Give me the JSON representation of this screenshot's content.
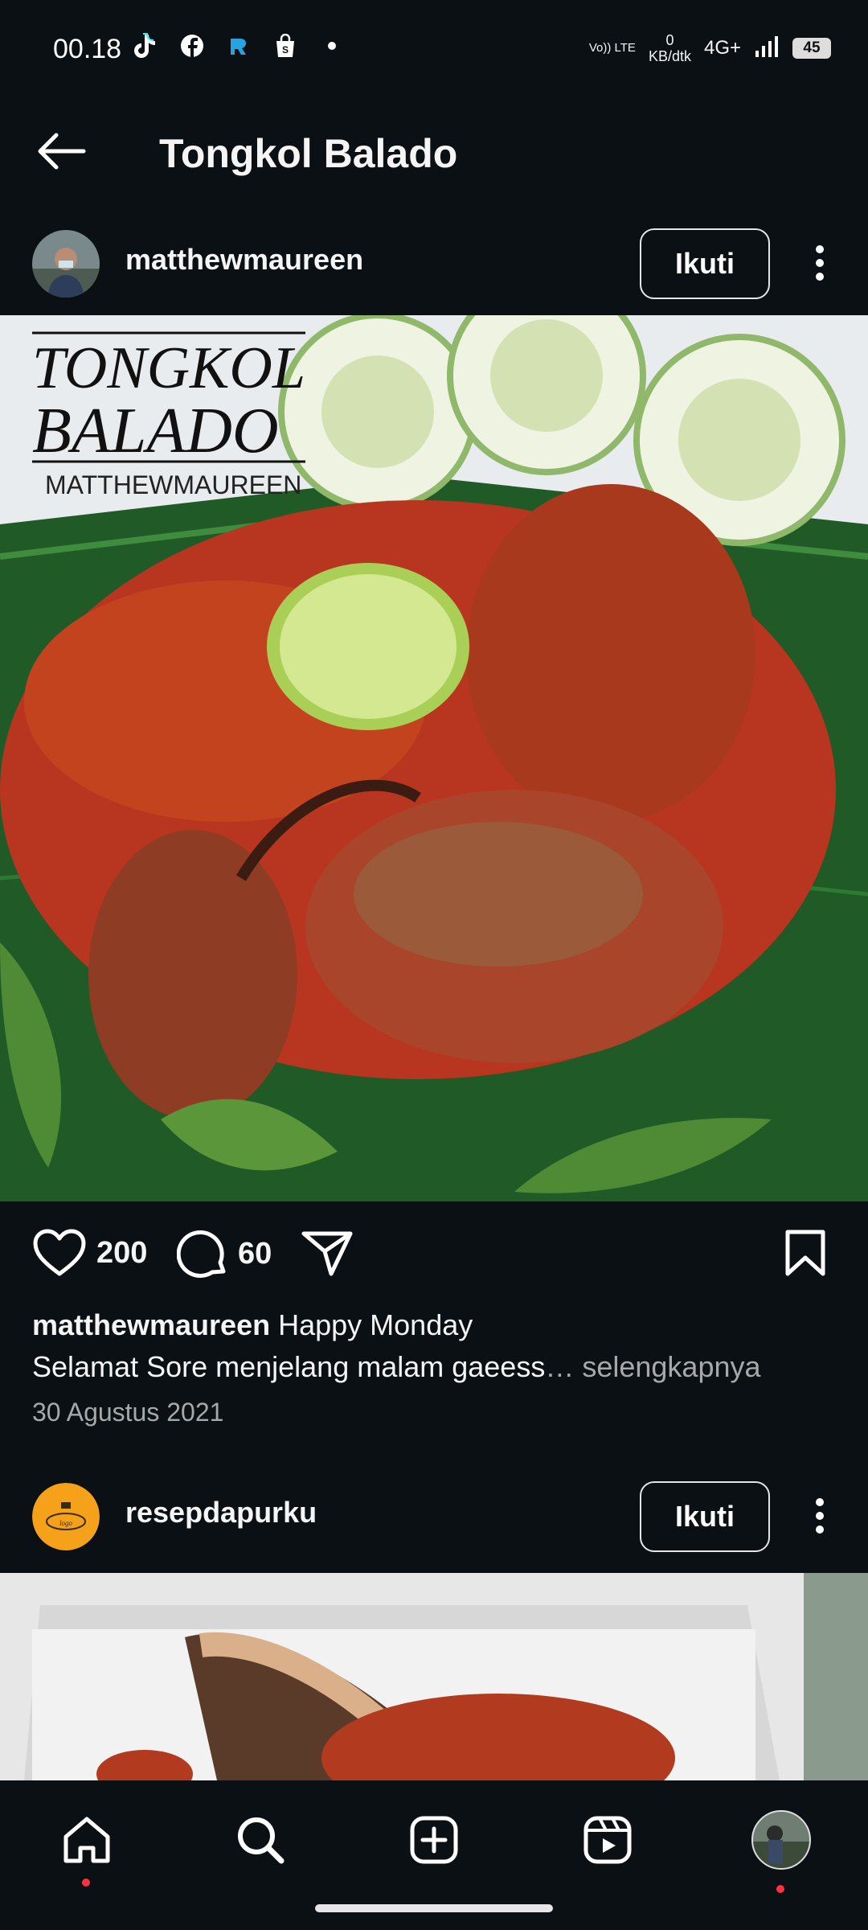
{
  "status_bar": {
    "time": "00.18",
    "app_icons": [
      "tiktok-icon",
      "facebook-icon",
      "app-icon",
      "shopping-bag-icon",
      "dot-icon"
    ],
    "volte": "Vo)) LTE",
    "net_value": "0",
    "net_unit": "KB/dtk",
    "network": "4G+",
    "battery": "45"
  },
  "header": {
    "title": "Tongkol Balado"
  },
  "post1": {
    "username": "matthewmaureen",
    "follow_label": "Ikuti",
    "image_overlay": {
      "line1": "TONGKOL",
      "line2": "BALADO",
      "line3": "MATTHEWMAUREEN"
    },
    "likes": "200",
    "comments": "60",
    "caption_user": "matthewmaureen",
    "caption_text": " Happy Monday",
    "caption_line2": "Selamat Sore menjelang malam gaeess",
    "caption_more": "… selengkapnya",
    "date": "30 Agustus 2021"
  },
  "post2": {
    "username": "resepdapurku",
    "follow_label": "Ikuti"
  },
  "nav": {
    "items": [
      "home-icon",
      "search-icon",
      "create-icon",
      "reels-icon",
      "profile-avatar"
    ]
  }
}
